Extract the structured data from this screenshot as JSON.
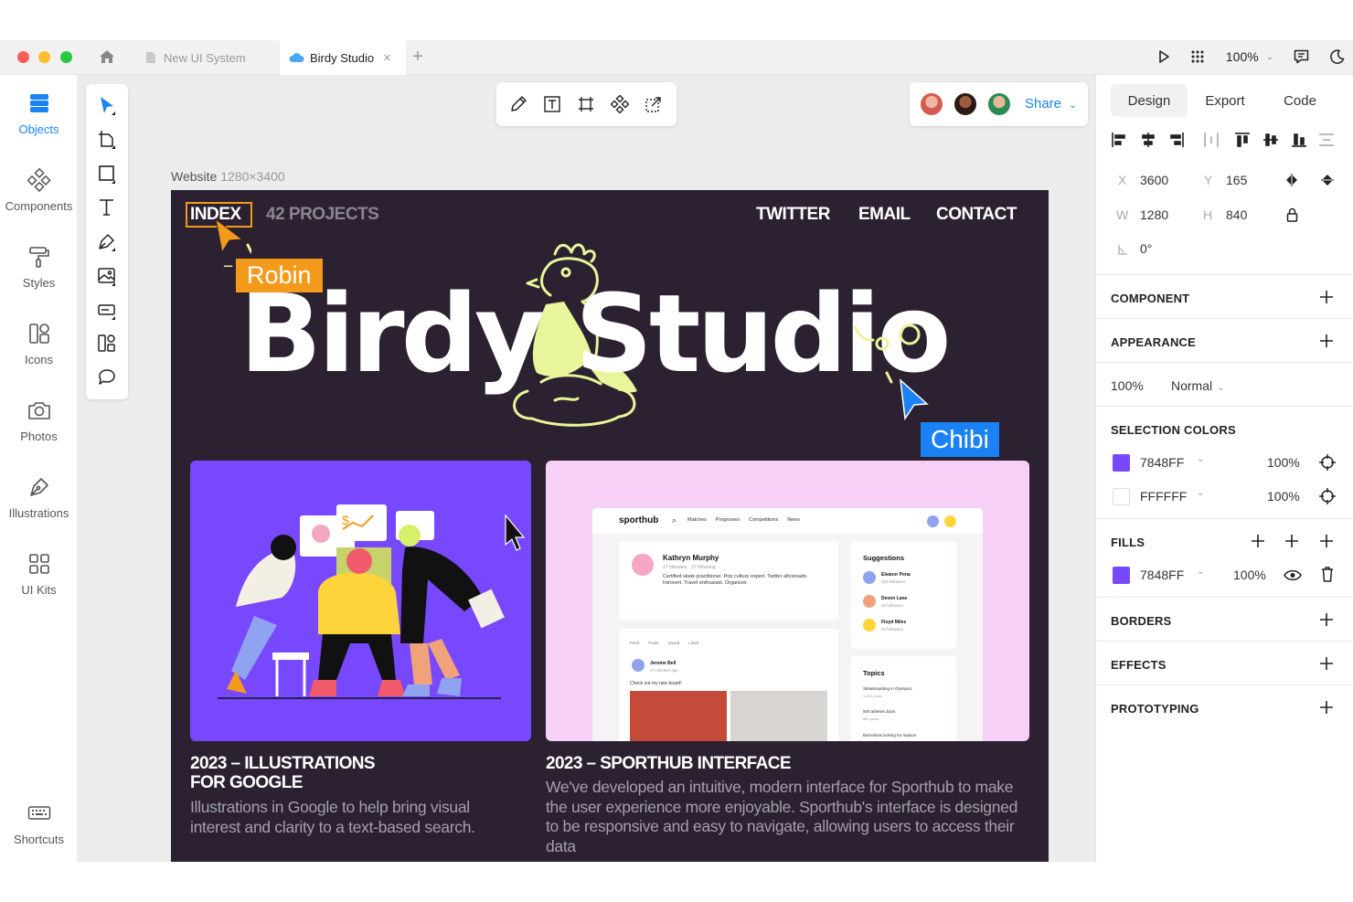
{
  "tabs": {
    "tab1": "New UI System",
    "tab2": "Birdy Studio"
  },
  "toolbar": {
    "zoom": "100%"
  },
  "sidebar": {
    "items": [
      {
        "label": "Objects",
        "icon": "layers-icon"
      },
      {
        "label": "Components",
        "icon": "components-icon"
      },
      {
        "label": "Styles",
        "icon": "paint-roller-icon"
      },
      {
        "label": "Icons",
        "icon": "icons-grid-icon"
      },
      {
        "label": "Photos",
        "icon": "camera-icon"
      },
      {
        "label": "Illustrations",
        "icon": "pen-nib-icon"
      },
      {
        "label": "UI Kits",
        "icon": "ui-kits-icon"
      }
    ],
    "shortcuts": "Shortcuts"
  },
  "share": {
    "label": "Share"
  },
  "frame": {
    "name": "Website",
    "size": "1280×3400",
    "nav": {
      "index": "INDEX",
      "projects": "42 PROJECTS",
      "twitter": "TWITTER",
      "email": "EMAIL",
      "contact": "CONTACT"
    },
    "title": "Birdy Studio",
    "cursors": {
      "robin": "Robin",
      "chibi": "Chibi"
    },
    "cards": [
      {
        "title_line1": "2023 – ILLUSTRATIONS",
        "title_line2": "FOR GOOGLE",
        "desc": "Illustrations in Google to help bring visual interest and clarity to a text-based search."
      },
      {
        "title_line1": "2023 – SPORTHUB INTERFACE",
        "desc": "We've developed an intuitive, modern interface for Sporthub to make the user experience more enjoyable. Sporthub's interface is designed to be responsive and easy to navigate, allowing users to access their data"
      }
    ],
    "sporthub": {
      "logo": "sporthub",
      "menu": [
        "Matches",
        "Prognoses",
        "Competitions",
        "News"
      ],
      "profile_name": "Kathryn Murphy",
      "profile_meta": "17 followers · 27 following",
      "profile_bio": "Certified skate practitioner. Pop culture expert. Twitter aficionado. Introvert. Travel enthusiast. Organizer.",
      "suggestions_title": "Suggestions",
      "suggestions": [
        {
          "name": "Eleanor Pena",
          "meta": "322 followers"
        },
        {
          "name": "Devon Lane",
          "meta": "25 followers"
        },
        {
          "name": "Floyd Miles",
          "meta": "84 followers"
        }
      ],
      "feed_tabs": [
        "Feed",
        "Posts",
        "Saved",
        "Liked"
      ],
      "post_author": "Jerome Bell",
      "post_time": "27 minutes ago",
      "post_text": "Check out my new board!",
      "topics_title": "Topics",
      "topics": [
        {
          "name": "Skateboarding in Olympics",
          "meta": "1,402 posts"
        },
        {
          "name": "500 athletes back",
          "meta": "842 posts"
        },
        {
          "name": "Barcelona looking for replace",
          "meta": ""
        }
      ]
    }
  },
  "panel": {
    "tabs": {
      "design": "Design",
      "export": "Export",
      "code": "Code"
    },
    "x_label": "X",
    "x": "3600",
    "y_label": "Y",
    "y": "165",
    "w_label": "W",
    "w": "1280",
    "h_label": "H",
    "h": "840",
    "rotation": "0°",
    "component": "COMPONENT",
    "appearance": "APPEARANCE",
    "opacity": "100%",
    "blend": "Normal",
    "selection_colors": "SELECTION COLORS",
    "sel_colors": [
      {
        "hex": "7848FF",
        "opacity": "100%",
        "swatch": "#7848ff"
      },
      {
        "hex": "FFFFFF",
        "opacity": "100%",
        "swatch": "#ffffff"
      }
    ],
    "fills": "FILLS",
    "fill": {
      "hex": "7848FF",
      "opacity": "100%",
      "swatch": "#7848ff"
    },
    "borders": "BORDERS",
    "effects": "EFFECTS",
    "prototyping": "PROTOTYPING"
  },
  "colors": {
    "accent": "#1b82f5",
    "frame_bg": "#2b2131",
    "robin": "#f39a1b",
    "chibi": "#1b82f5",
    "card1_bg": "#7848ff",
    "card2_bg": "#f6d0f7",
    "doodle": "#e9f59a"
  }
}
